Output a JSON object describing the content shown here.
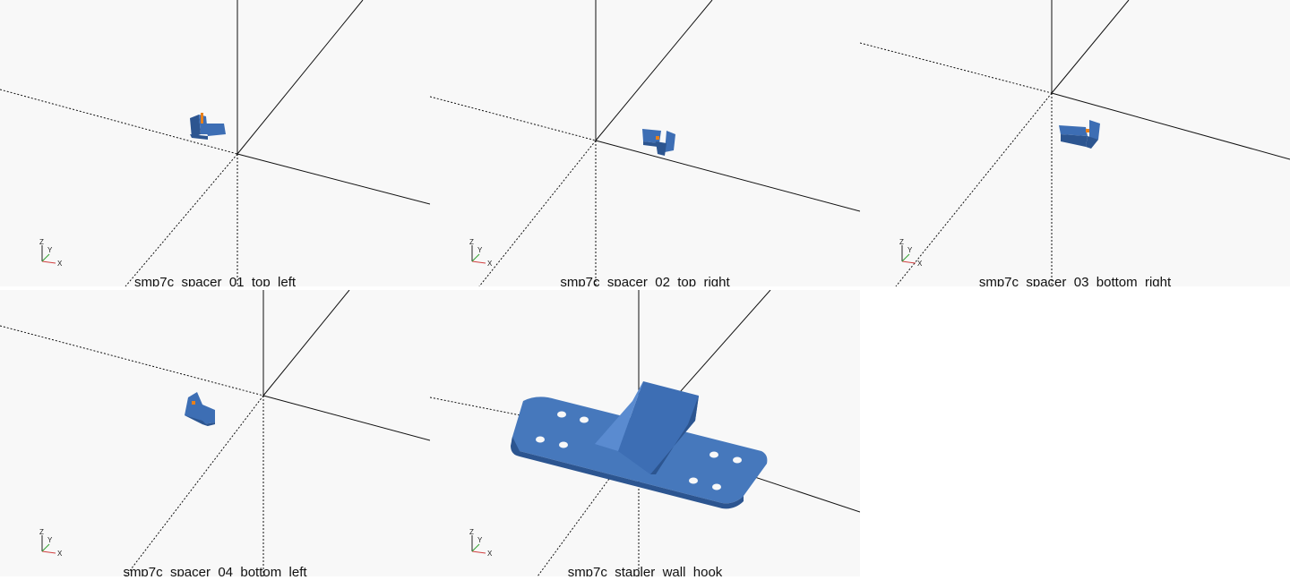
{
  "panels": [
    {
      "caption": "smp7c_spacer_01_top_left"
    },
    {
      "caption": "smp7c_spacer_02_top_right"
    },
    {
      "caption": "smp7c_spacer_03_bottom_right"
    },
    {
      "caption": "smp7c_spacer_04_bottom_left"
    },
    {
      "caption": "smp7c_stapler_wall_hook"
    }
  ],
  "axis_gizmo": {
    "x_label": "X",
    "y_label": "Y",
    "z_label": "Z"
  },
  "colors": {
    "viewport_background": "#f8f8f8",
    "model_blue": "#3d6eb4",
    "model_shadow": "#2c5590",
    "highlight_orange": "#e8801a"
  }
}
